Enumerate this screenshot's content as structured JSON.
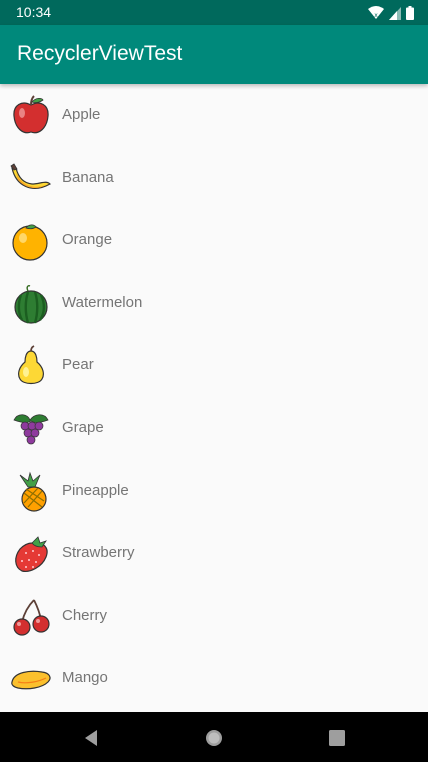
{
  "status_bar": {
    "time": "10:34"
  },
  "app_bar": {
    "title": "RecyclerViewTest"
  },
  "fruits": [
    {
      "name": "Apple",
      "icon": "apple-icon"
    },
    {
      "name": "Banana",
      "icon": "banana-icon"
    },
    {
      "name": "Orange",
      "icon": "orange-icon"
    },
    {
      "name": "Watermelon",
      "icon": "watermelon-icon"
    },
    {
      "name": "Pear",
      "icon": "pear-icon"
    },
    {
      "name": "Grape",
      "icon": "grape-icon"
    },
    {
      "name": "Pineapple",
      "icon": "pineapple-icon"
    },
    {
      "name": "Strawberry",
      "icon": "strawberry-icon"
    },
    {
      "name": "Cherry",
      "icon": "cherry-icon"
    },
    {
      "name": "Mango",
      "icon": "mango-icon"
    }
  ],
  "colors": {
    "status_bar": "#00695c",
    "app_bar": "#00897b",
    "background": "#fafafa",
    "label": "#757575"
  }
}
